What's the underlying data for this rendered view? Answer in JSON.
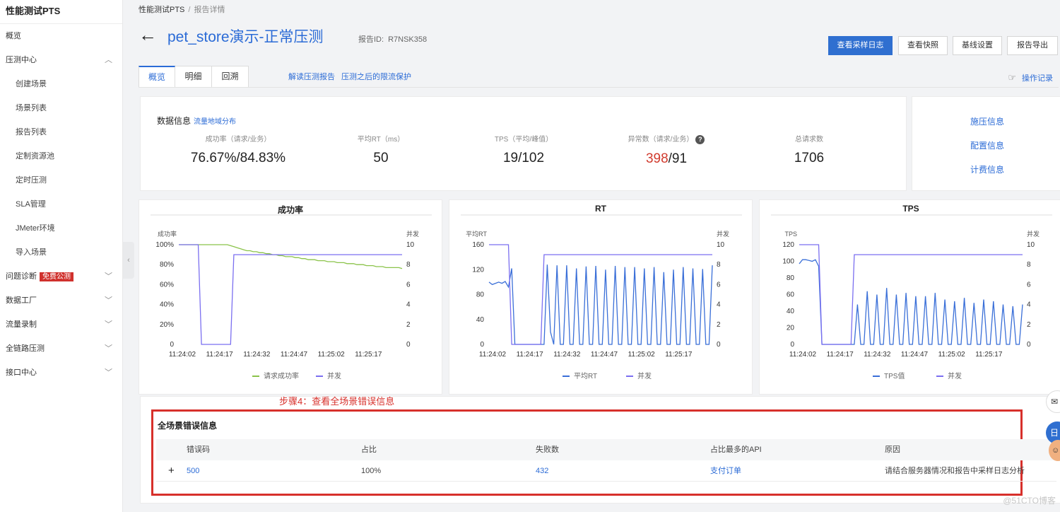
{
  "sidebar": {
    "title": "性能测试PTS",
    "items": [
      {
        "label": "概览",
        "sub": false,
        "chev": ""
      },
      {
        "label": "压测中心",
        "sub": false,
        "chev": "up"
      },
      {
        "label": "创建场景",
        "sub": true,
        "chev": ""
      },
      {
        "label": "场景列表",
        "sub": true,
        "chev": ""
      },
      {
        "label": "报告列表",
        "sub": true,
        "chev": ""
      },
      {
        "label": "定制资源池",
        "sub": true,
        "chev": ""
      },
      {
        "label": "定时压测",
        "sub": true,
        "chev": ""
      },
      {
        "label": "SLA管理",
        "sub": true,
        "chev": ""
      },
      {
        "label": "JMeter环境",
        "sub": true,
        "chev": ""
      },
      {
        "label": "导入场景",
        "sub": true,
        "chev": ""
      },
      {
        "label": "问题诊断",
        "sub": false,
        "chev": "down",
        "badge": "免费公测"
      },
      {
        "label": "数据工厂",
        "sub": false,
        "chev": "down"
      },
      {
        "label": "流量录制",
        "sub": false,
        "chev": "down"
      },
      {
        "label": "全链路压测",
        "sub": false,
        "chev": "down"
      },
      {
        "label": "接口中心",
        "sub": false,
        "chev": "down"
      }
    ]
  },
  "breadcrumb": {
    "root": "性能测试PTS",
    "sep": "/",
    "current": "报告详情"
  },
  "header": {
    "title": "pet_store演示-正常压测",
    "report_id_label": "报告ID:",
    "report_id": "R7NSK358"
  },
  "buttons": {
    "sample_log": "查看采样日志",
    "snapshot": "查看快照",
    "baseline": "基线设置",
    "export": "报告导出"
  },
  "tabs": [
    "概览",
    "明细",
    "回溯"
  ],
  "tab_links": {
    "interpret": "解读压测报告",
    "throttle": "压测之后的限流保护"
  },
  "op_log": "操作记录",
  "data_info": {
    "title": "数据信息",
    "link": "流量地域分布",
    "metrics": [
      {
        "label": "成功率（请求/业务）",
        "value": "76.67%/84.83%"
      },
      {
        "label": "平均RT（ms）",
        "value": "50"
      },
      {
        "label": "TPS（平均/峰值）",
        "value": "19/102"
      },
      {
        "label": "异常数（请求/业务）",
        "value_red": "398",
        "value_rest": "/91"
      },
      {
        "label": "总请求数",
        "value": "1706"
      }
    ]
  },
  "side_links": [
    "施压信息",
    "配置信息",
    "计费信息"
  ],
  "colors": {
    "accent": "#2b6bd6",
    "danger": "#d7302b",
    "green": "#8bc34a",
    "purple": "#7b6ff0",
    "blue": "#3a6fd8"
  },
  "chart_data": [
    {
      "type": "line",
      "title": "成功率",
      "ylabel": "成功率",
      "y2label": "并发",
      "x": [
        "11:24:02",
        "11:24:17",
        "11:24:32",
        "11:24:47",
        "11:25:02",
        "11:25:17"
      ],
      "yticks": [
        "0",
        "20%",
        "40%",
        "60%",
        "80%",
        "100%"
      ],
      "y2ticks": [
        "0",
        "2",
        "4",
        "6",
        "8",
        "10"
      ],
      "ylim": [
        0,
        100
      ],
      "y2lim": [
        0,
        10
      ],
      "series": [
        {
          "name": "请求成功率",
          "axis": "left",
          "color": "#8bc34a",
          "values": [
            100,
            100,
            100,
            100,
            100,
            100,
            100,
            100,
            100,
            100,
            100,
            100,
            100,
            100,
            100,
            100,
            99,
            98,
            97,
            96,
            95,
            94,
            94,
            93,
            93,
            92,
            92,
            91,
            91,
            90,
            90,
            89,
            89,
            88,
            88,
            88,
            87,
            87,
            86,
            86,
            85,
            85,
            85,
            84,
            84,
            84,
            83,
            83,
            83,
            82,
            82,
            82,
            81,
            81,
            81,
            80,
            80,
            80,
            79,
            79,
            79,
            78,
            78,
            78,
            77,
            77,
            77,
            77,
            77,
            76
          ]
        },
        {
          "name": "并发",
          "axis": "right",
          "color": "#7b6ff0",
          "values": [
            10,
            10,
            10,
            10,
            10,
            10,
            10,
            0,
            0,
            0,
            0,
            0,
            0,
            0,
            0,
            0,
            0,
            9,
            9,
            9,
            9,
            9,
            9,
            9,
            9,
            9,
            9,
            9,
            9,
            9,
            9,
            9,
            9,
            9,
            9,
            9,
            9,
            9,
            9,
            9,
            9,
            9,
            9,
            9,
            9,
            9,
            9,
            9,
            9,
            9,
            9,
            9,
            9,
            9,
            9,
            9,
            9,
            9,
            9,
            9,
            9,
            9,
            9,
            9,
            9,
            9,
            9,
            9,
            9,
            9
          ]
        }
      ]
    },
    {
      "type": "line",
      "title": "RT",
      "ylabel": "平均RT",
      "y2label": "并发",
      "x": [
        "11:24:02",
        "11:24:17",
        "11:24:32",
        "11:24:47",
        "11:25:02",
        "11:25:17"
      ],
      "yticks": [
        "0",
        "40",
        "80",
        "120",
        "160"
      ],
      "y2ticks": [
        "0",
        "2",
        "4",
        "6",
        "8",
        "10"
      ],
      "ylim": [
        0,
        160
      ],
      "y2lim": [
        0,
        10
      ],
      "series": [
        {
          "name": "平均RT",
          "axis": "left",
          "color": "#3a6fd8",
          "values": [
            100,
            96,
            98,
            100,
            98,
            101,
            92,
            122,
            0,
            0,
            0,
            0,
            0,
            0,
            0,
            0,
            0,
            0,
            128,
            20,
            0,
            127,
            0,
            0,
            127,
            0,
            0,
            122,
            0,
            0,
            125,
            0,
            0,
            126,
            0,
            0,
            120,
            0,
            0,
            126,
            0,
            0,
            124,
            0,
            0,
            124,
            0,
            0,
            122,
            0,
            0,
            124,
            0,
            0,
            116,
            0,
            0,
            120,
            0,
            0,
            124,
            0,
            0,
            122,
            0,
            0,
            121,
            0,
            0,
            127
          ]
        },
        {
          "name": "并发",
          "axis": "right",
          "color": "#7b6ff0",
          "values": [
            10,
            10,
            10,
            10,
            10,
            10,
            10,
            0,
            0,
            0,
            0,
            0,
            0,
            0,
            0,
            0,
            0,
            9,
            9,
            9,
            9,
            9,
            9,
            9,
            9,
            9,
            9,
            9,
            9,
            9,
            9,
            9,
            9,
            9,
            9,
            9,
            9,
            9,
            9,
            9,
            9,
            9,
            9,
            9,
            9,
            9,
            9,
            9,
            9,
            9,
            9,
            9,
            9,
            9,
            9,
            9,
            9,
            9,
            9,
            9,
            9,
            9,
            9,
            9,
            9,
            9,
            9,
            9,
            9,
            9
          ]
        }
      ]
    },
    {
      "type": "line",
      "title": "TPS",
      "ylabel": "TPS",
      "y2label": "并发",
      "x": [
        "11:24:02",
        "11:24:17",
        "11:24:32",
        "11:24:47",
        "11:25:02",
        "11:25:17"
      ],
      "yticks": [
        "0",
        "20",
        "40",
        "60",
        "80",
        "100",
        "120"
      ],
      "y2ticks": [
        "0",
        "2",
        "4",
        "6",
        "8",
        "10"
      ],
      "ylim": [
        0,
        120
      ],
      "y2lim": [
        0,
        10
      ],
      "series": [
        {
          "name": "TPS值",
          "axis": "left",
          "color": "#3a6fd8",
          "values": [
            97,
            102,
            102,
            101,
            100,
            102,
            94,
            0,
            0,
            0,
            0,
            0,
            0,
            0,
            0,
            0,
            0,
            0,
            48,
            0,
            0,
            64,
            0,
            0,
            60,
            0,
            0,
            68,
            0,
            0,
            60,
            0,
            0,
            62,
            0,
            0,
            58,
            0,
            0,
            58,
            0,
            0,
            62,
            0,
            0,
            54,
            0,
            0,
            52,
            0,
            0,
            56,
            0,
            0,
            50,
            0,
            0,
            54,
            0,
            0,
            52,
            0,
            0,
            48,
            0,
            0,
            46,
            0,
            0,
            48
          ]
        },
        {
          "name": "并发",
          "axis": "right",
          "color": "#7b6ff0",
          "values": [
            10,
            10,
            10,
            10,
            10,
            10,
            10,
            0,
            0,
            0,
            0,
            0,
            0,
            0,
            0,
            0,
            0,
            9,
            9,
            9,
            9,
            9,
            9,
            9,
            9,
            9,
            9,
            9,
            9,
            9,
            9,
            9,
            9,
            9,
            9,
            9,
            9,
            9,
            9,
            9,
            9,
            9,
            9,
            9,
            9,
            9,
            9,
            9,
            9,
            9,
            9,
            9,
            9,
            9,
            9,
            9,
            9,
            9,
            9,
            9,
            9,
            9,
            9,
            9,
            9,
            9,
            9,
            9,
            9,
            9
          ]
        }
      ]
    }
  ],
  "step_annotation": "步骤4：查看全场景错误信息",
  "errors": {
    "title": "全场景错误信息",
    "columns": [
      "错误码",
      "占比",
      "失败数",
      "占比最多的API",
      "原因"
    ],
    "rows": [
      {
        "code": "500",
        "ratio": "100%",
        "fail_count": "432",
        "api": "支付订单",
        "reason": "请结合服务器情况和报告中采样日志分析"
      }
    ]
  },
  "watermark": "@51CTO博客"
}
